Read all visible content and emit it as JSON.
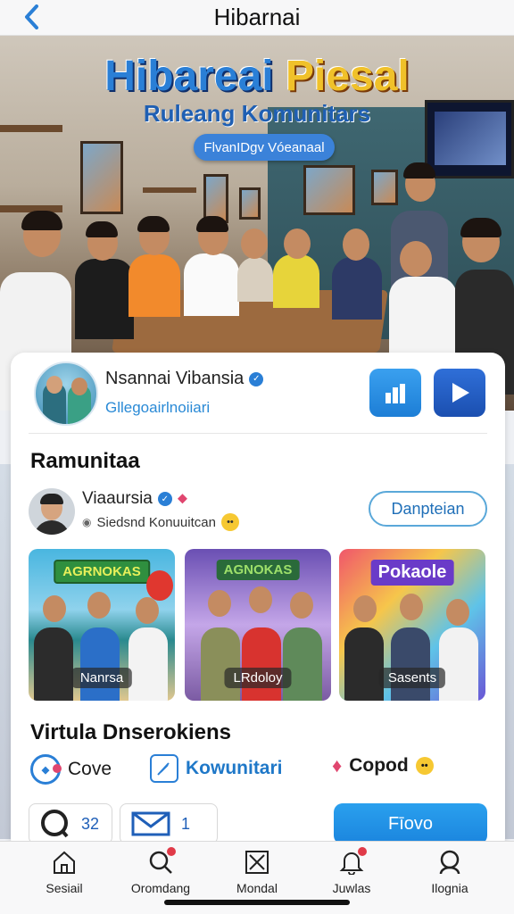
{
  "header": {
    "title": "Hibarnai"
  },
  "hero": {
    "title_part1": "Hibareai",
    "title_part2": "Piesal",
    "subtitle": "Ruleang Komunitars",
    "chip": "FlvanIDgv Vóeanaal"
  },
  "profile": {
    "name": "Nsannai Vibansia",
    "handle": "Gllegoairlnoiiari"
  },
  "community": {
    "title": "Ramunitaa",
    "user_name": "Viaaursia",
    "user_sub": "Siedsnd Konuuitcan",
    "action_label": "Danpteian"
  },
  "thumbnails": [
    {
      "badge": "AGRNOKAS",
      "label": "Nanrsa"
    },
    {
      "badge": "AGNOKAS",
      "label": "LRdoloy"
    },
    {
      "badge": "Pokaole",
      "label": "Sasents"
    }
  ],
  "virtual": {
    "title": "Virtula Dnserokiens",
    "items": [
      {
        "label": "Cove",
        "icon": "community-logo-icon"
      },
      {
        "label": "Kowunitari",
        "icon": "feather-icon"
      },
      {
        "label": "Copod",
        "icon": "sparkle-icon"
      }
    ]
  },
  "stats": {
    "comments": "32",
    "messages": "1",
    "follow_label": "Fīovo"
  },
  "nav": [
    {
      "label": "Sesiail",
      "icon": "home-icon"
    },
    {
      "label": "Oromdang",
      "icon": "search-icon"
    },
    {
      "label": "Mondal",
      "icon": "gallery-icon"
    },
    {
      "label": "Juwlas",
      "icon": "bell-icon"
    },
    {
      "label": "Ilognia",
      "icon": "profile-search-icon"
    }
  ],
  "colors": {
    "accent": "#2a7fd6",
    "button": "#1b85de",
    "notification": "#e03a48"
  }
}
